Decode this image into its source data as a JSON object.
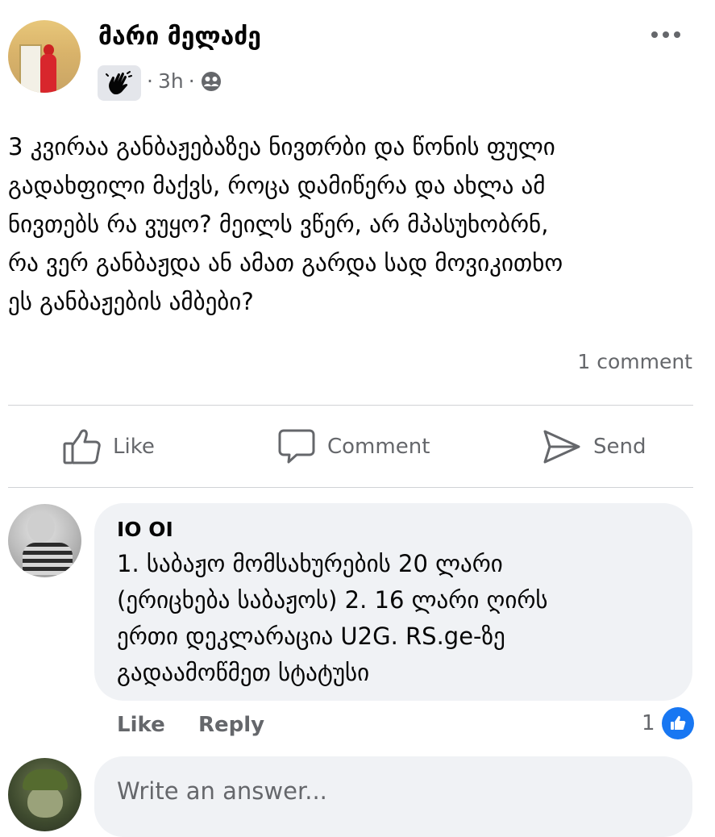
{
  "post": {
    "author_name": "მარი მელაძე",
    "time": "3h",
    "separator": "·",
    "audience_icon": "friends-icon",
    "badge_icon": "waving-hand-icon",
    "text": "3 კვირაა განბაჟებაზეა ნივთრბი და წონის ფული\nგადახფილი მაქვს, როცა დამიწერა და ახლა ამ\nნივთებს რა ვუყო? მეილს ვწერ, არ მპასუხობრნ,\nრა ვერ განბაჟდა ან ამათ გარდა სად მოვიკითხო\nეს განბაჟების ამბები?",
    "comment_count": "1 comment"
  },
  "actions": {
    "like": "Like",
    "comment": "Comment",
    "send": "Send"
  },
  "comment": {
    "author_name": "IO OI",
    "text": "1. საბაჟო მომსახურების 20 ლარი\n(ერიცხება საბაჟოს)  2. 16 ლარი ღირს\nერთი დეკლარაცია U2G. RS.ge-ზე\nგადაამოწმეთ სტატუსი",
    "like_label": "Like",
    "reply_label": "Reply",
    "reaction_count": "1",
    "reaction_icon": "thumbs-up-icon"
  },
  "composer": {
    "placeholder": "Write an answer..."
  },
  "colors": {
    "text_primary": "#050505",
    "text_secondary": "#65676b",
    "bubble_bg": "#f0f2f5",
    "reaction_blue": "#1877f2",
    "divider": "#d0d2d6"
  }
}
